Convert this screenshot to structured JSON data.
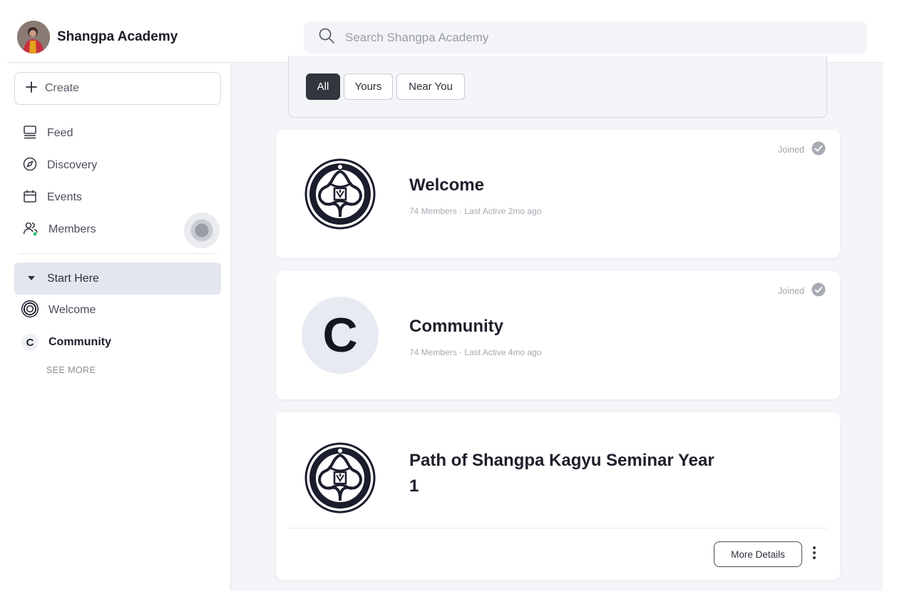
{
  "header": {
    "brand_name": "Shangpa Academy",
    "search_placeholder": "Search Shangpa Academy"
  },
  "sidebar": {
    "create_label": "Create",
    "nav": [
      {
        "label": "Feed",
        "icon": "feed-icon"
      },
      {
        "label": "Discovery",
        "icon": "compass-icon"
      },
      {
        "label": "Events",
        "icon": "calendar-icon"
      },
      {
        "label": "Members",
        "icon": "members-icon"
      }
    ],
    "section": {
      "label": "Start Here",
      "items": [
        {
          "label": "Welcome",
          "icon": "emblem-icon"
        },
        {
          "label": "Community",
          "icon_letter": "C"
        }
      ],
      "see_more": "SEE MORE"
    }
  },
  "filters": {
    "chips": [
      {
        "label": "All",
        "active": true
      },
      {
        "label": "Yours",
        "active": false
      },
      {
        "label": "Near You",
        "active": false
      }
    ]
  },
  "groups": [
    {
      "title": "Welcome",
      "meta": "74 Members · Last Active 2mo ago",
      "status": "Joined",
      "icon": "emblem-icon"
    },
    {
      "title": "Community",
      "meta": "74 Members · Last Active 4mo ago",
      "status": "Joined",
      "icon_letter": "C"
    },
    {
      "title_line1": "Path of Shangpa Kagyu Seminar Year",
      "title_line2": "1",
      "icon": "emblem-icon",
      "more_details_label": "More Details"
    }
  ],
  "colors": {
    "accent_dark": "#33363e",
    "background": "#f4f5f9",
    "online_dot": "#2fbf71"
  }
}
